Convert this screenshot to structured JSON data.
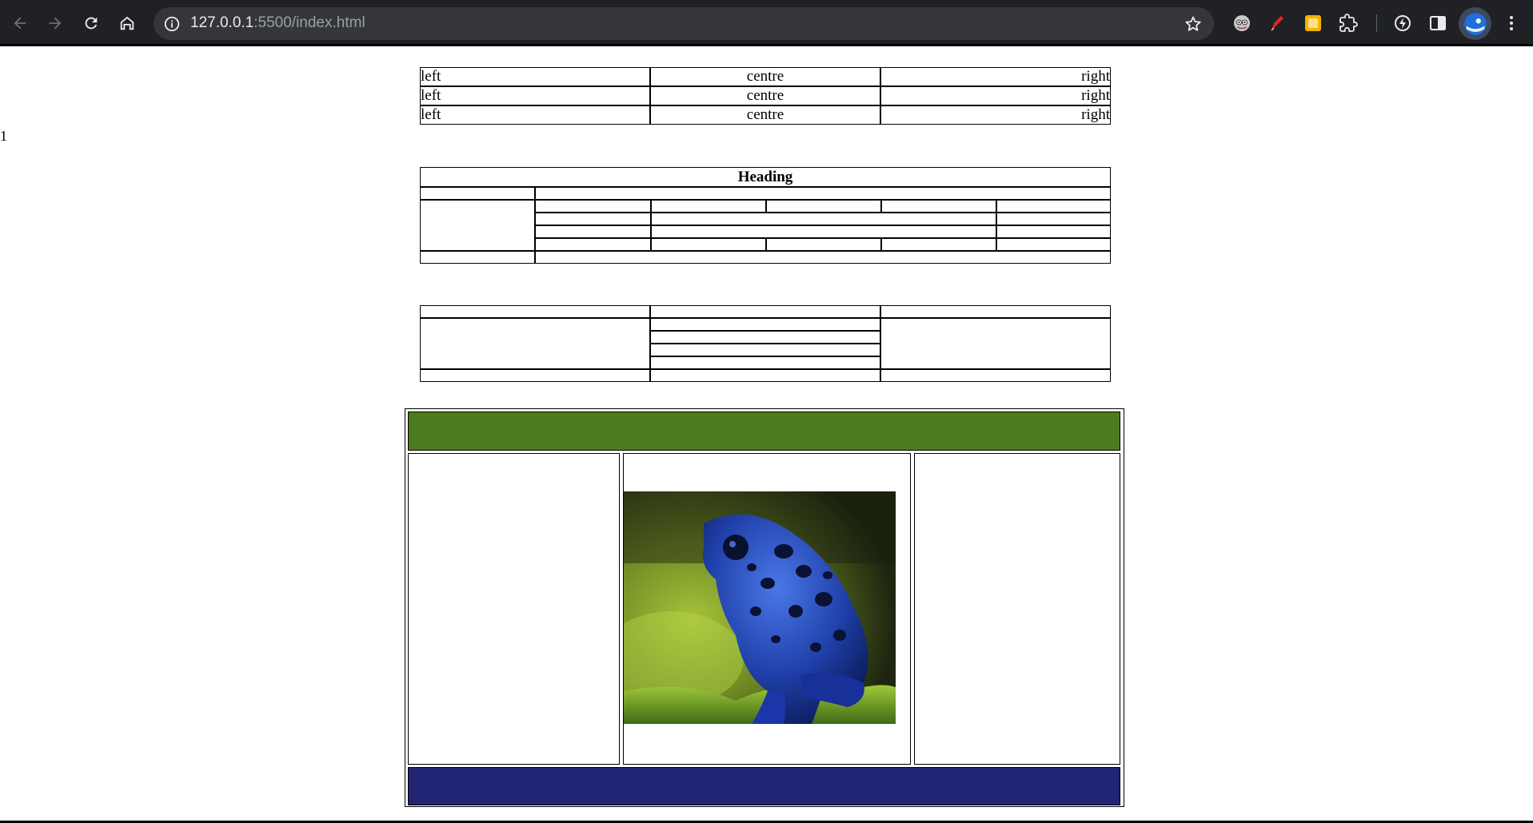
{
  "browser": {
    "url_host": "127.0.0.1",
    "url_rest": ":5500/index.html",
    "icons": [
      "back-arrow-icon",
      "forward-arrow-icon",
      "reload-icon",
      "home-icon",
      "site-info-icon",
      "bookmark-star-icon",
      "extension-icon",
      "profile-avatar-icon",
      "menu-kebab-icon"
    ]
  },
  "page": {
    "stray_text": "1",
    "table1": {
      "rows": [
        {
          "left": "left",
          "centre": "centre",
          "right": "right"
        },
        {
          "left": "left",
          "centre": "centre",
          "right": "right"
        },
        {
          "left": "left",
          "centre": "centre",
          "right": "right"
        }
      ]
    },
    "table2": {
      "heading": "Heading"
    },
    "layout": {
      "header_color": "#4f7b1f",
      "footer_color": "#222474",
      "image_subject": "blue poison dart frog"
    }
  }
}
